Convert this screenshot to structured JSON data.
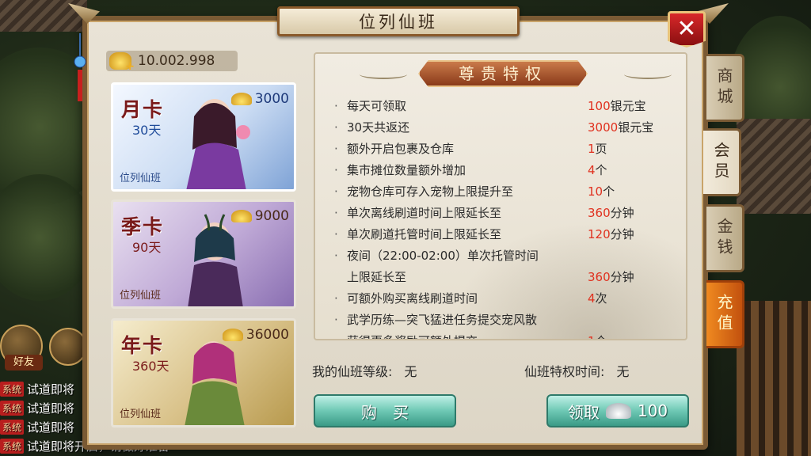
{
  "window": {
    "title": "位列仙班",
    "close_icon": "close-icon"
  },
  "balance": {
    "value": "10.002.998",
    "icon": "gold-ingot-plus-icon"
  },
  "cards": [
    {
      "name": "月卡",
      "days": "30天",
      "price": "3000",
      "tag": "位列仙班",
      "color": "#cbdcf3"
    },
    {
      "name": "季卡",
      "days": "90天",
      "price": "9000",
      "tag": "位列仙班",
      "color": "#bfa9d6"
    },
    {
      "name": "年卡",
      "days": "360天",
      "price": "36000",
      "tag": "位列仙班",
      "color": "#d9c28a"
    }
  ],
  "panel": {
    "title": "尊贵特权",
    "rows": [
      {
        "bullet": "·",
        "text": "每天可领取",
        "num": "100",
        "unit": "银元宝"
      },
      {
        "bullet": "·",
        "text": "30天共返还",
        "num": "3000",
        "unit": "银元宝"
      },
      {
        "bullet": "·",
        "text": "额外开启包裹及仓库",
        "num": "1",
        "unit": "页"
      },
      {
        "bullet": "·",
        "text": "集市摊位数量额外增加",
        "num": "4",
        "unit": "个"
      },
      {
        "bullet": "·",
        "text": "宠物仓库可存入宠物上限提升至",
        "num": "10",
        "unit": "个"
      },
      {
        "bullet": "·",
        "text": "单次离线刷道时间上限延长至",
        "num": "360",
        "unit": "分钟"
      },
      {
        "bullet": "·",
        "text": "单次刷道托管时间上限延长至",
        "num": "120",
        "unit": "分钟"
      },
      {
        "bullet": "·",
        "text": "夜间（22:00-02:00）单次托管时间",
        "num": "",
        "unit": ""
      },
      {
        "bullet": "",
        "text": "上限延长至",
        "num": "360",
        "unit": "分钟"
      },
      {
        "bullet": "·",
        "text": "可额外购买离线刷道时间",
        "num": "4",
        "unit": "次"
      },
      {
        "bullet": "·",
        "text": "武学历练—突飞猛进任务提交宠风散",
        "num": "",
        "unit": ""
      },
      {
        "bullet": "",
        "text": "获得更多奖励可额外提交",
        "num": "1",
        "unit": "个"
      }
    ]
  },
  "info": {
    "level_label": "我的仙班等级:",
    "level_value": "无",
    "time_label": "仙班特权时间:",
    "time_value": "无"
  },
  "buttons": {
    "buy": "购　买",
    "claim": "领取",
    "claim_amount": "100"
  },
  "side_tabs": [
    "商城",
    "会员",
    "金钱",
    "充值"
  ],
  "chat": {
    "friend_label": "好友",
    "system_tag": "系统",
    "lines": [
      "试道即将",
      "试道即将",
      "试道即将",
      "试道即将开启，请做好准备"
    ]
  },
  "colors": {
    "accent_red": "#e0301e",
    "button_teal": "#6ec8b4",
    "frame": "#7a5a34"
  }
}
